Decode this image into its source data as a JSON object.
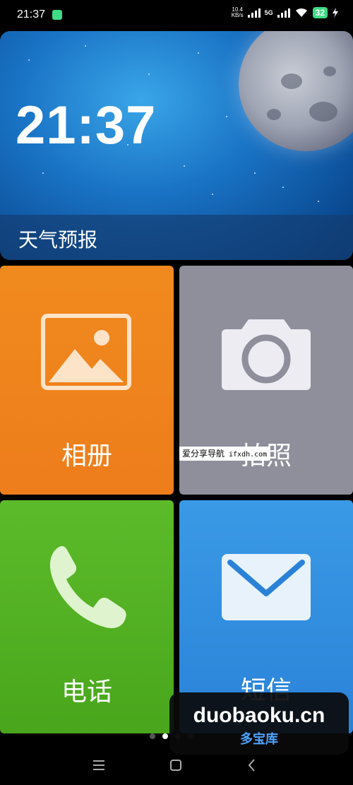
{
  "status_bar": {
    "time": "21:37",
    "net_speed_value": "10.4",
    "net_speed_unit": "KB/s",
    "network": "5G",
    "battery": "32"
  },
  "clock_widget": {
    "time": "21:37",
    "weather_label": "天气预报"
  },
  "tiles": {
    "album": {
      "label": "相册",
      "color": "#F08A1E"
    },
    "camera": {
      "label": "拍照",
      "color": "#8E8F9B"
    },
    "phone": {
      "label": "电话",
      "color": "#5CBB2A"
    },
    "sms": {
      "label": "短信",
      "color": "#3A9AE6"
    }
  },
  "watermarks": {
    "strip_text": "爱分享导航",
    "strip_url": "ifxdh.com",
    "site": "duobaoku.cn",
    "site_cn": "多宝库"
  },
  "pager": {
    "page_count": 4,
    "current": 2
  },
  "nav": {
    "menu": "menu-icon",
    "home": "home-icon",
    "back": "back-icon"
  }
}
